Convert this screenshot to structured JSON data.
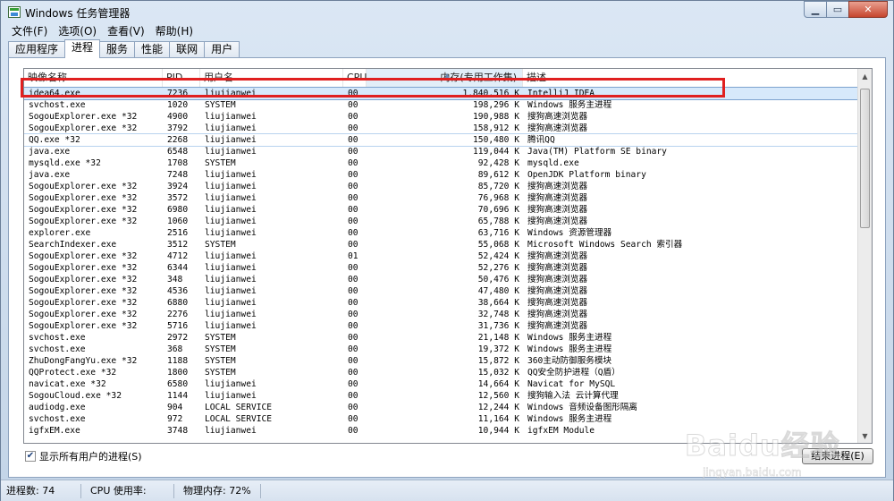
{
  "window": {
    "title": "Windows 任务管理器",
    "controls": [
      "▁",
      "▭",
      "✕"
    ]
  },
  "menu": [
    "文件(F)",
    "选项(O)",
    "查看(V)",
    "帮助(H)"
  ],
  "tabs": [
    {
      "label": "应用程序",
      "active": false
    },
    {
      "label": "进程",
      "active": true
    },
    {
      "label": "服务",
      "active": false
    },
    {
      "label": "性能",
      "active": false
    },
    {
      "label": "联网",
      "active": false
    },
    {
      "label": "用户",
      "active": false
    }
  ],
  "columns": {
    "name": "映像名称",
    "pid": "PID",
    "user": "用户名",
    "cpu": "CPU",
    "mem": "内存(专用工作集)",
    "desc": "描述"
  },
  "processes": [
    {
      "name": "idea64.exe",
      "pid": "7236",
      "user": "liujianwei",
      "cpu": "00",
      "mem": "1,840,516 K",
      "desc": "IntelliJ IDEA"
    },
    {
      "name": "svchost.exe",
      "pid": "1020",
      "user": "SYSTEM",
      "cpu": "00",
      "mem": "198,296 K",
      "desc": "Windows 服务主进程"
    },
    {
      "name": "SogouExplorer.exe *32",
      "pid": "4900",
      "user": "liujianwei",
      "cpu": "00",
      "mem": "190,988 K",
      "desc": "搜狗高速浏览器"
    },
    {
      "name": "SogouExplorer.exe *32",
      "pid": "3792",
      "user": "liujianwei",
      "cpu": "00",
      "mem": "158,912 K",
      "desc": "搜狗高速浏览器"
    },
    {
      "name": "QQ.exe *32",
      "pid": "2268",
      "user": "liujianwei",
      "cpu": "00",
      "mem": "150,480 K",
      "desc": "腾讯QQ"
    },
    {
      "name": "java.exe",
      "pid": "6548",
      "user": "liujianwei",
      "cpu": "00",
      "mem": "119,044 K",
      "desc": "Java(TM) Platform SE binary"
    },
    {
      "name": "mysqld.exe *32",
      "pid": "1708",
      "user": "SYSTEM",
      "cpu": "00",
      "mem": "92,428 K",
      "desc": "mysqld.exe"
    },
    {
      "name": "java.exe",
      "pid": "7248",
      "user": "liujianwei",
      "cpu": "00",
      "mem": "89,612 K",
      "desc": "OpenJDK Platform binary"
    },
    {
      "name": "SogouExplorer.exe *32",
      "pid": "3924",
      "user": "liujianwei",
      "cpu": "00",
      "mem": "85,720 K",
      "desc": "搜狗高速浏览器"
    },
    {
      "name": "SogouExplorer.exe *32",
      "pid": "3572",
      "user": "liujianwei",
      "cpu": "00",
      "mem": "76,968 K",
      "desc": "搜狗高速浏览器"
    },
    {
      "name": "SogouExplorer.exe *32",
      "pid": "6980",
      "user": "liujianwei",
      "cpu": "00",
      "mem": "70,696 K",
      "desc": "搜狗高速浏览器"
    },
    {
      "name": "SogouExplorer.exe *32",
      "pid": "1060",
      "user": "liujianwei",
      "cpu": "00",
      "mem": "65,788 K",
      "desc": "搜狗高速浏览器"
    },
    {
      "name": "explorer.exe",
      "pid": "2516",
      "user": "liujianwei",
      "cpu": "00",
      "mem": "63,716 K",
      "desc": "Windows 资源管理器"
    },
    {
      "name": "SearchIndexer.exe",
      "pid": "3512",
      "user": "SYSTEM",
      "cpu": "00",
      "mem": "55,068 K",
      "desc": "Microsoft Windows Search 索引器"
    },
    {
      "name": "SogouExplorer.exe *32",
      "pid": "4712",
      "user": "liujianwei",
      "cpu": "01",
      "mem": "52,424 K",
      "desc": "搜狗高速浏览器"
    },
    {
      "name": "SogouExplorer.exe *32",
      "pid": "6344",
      "user": "liujianwei",
      "cpu": "00",
      "mem": "52,276 K",
      "desc": "搜狗高速浏览器"
    },
    {
      "name": "SogouExplorer.exe *32",
      "pid": "348",
      "user": "liujianwei",
      "cpu": "00",
      "mem": "50,476 K",
      "desc": "搜狗高速浏览器"
    },
    {
      "name": "SogouExplorer.exe *32",
      "pid": "4536",
      "user": "liujianwei",
      "cpu": "00",
      "mem": "47,480 K",
      "desc": "搜狗高速浏览器"
    },
    {
      "name": "SogouExplorer.exe *32",
      "pid": "6880",
      "user": "liujianwei",
      "cpu": "00",
      "mem": "38,664 K",
      "desc": "搜狗高速浏览器"
    },
    {
      "name": "SogouExplorer.exe *32",
      "pid": "2276",
      "user": "liujianwei",
      "cpu": "00",
      "mem": "32,748 K",
      "desc": "搜狗高速浏览器"
    },
    {
      "name": "SogouExplorer.exe *32",
      "pid": "5716",
      "user": "liujianwei",
      "cpu": "00",
      "mem": "31,736 K",
      "desc": "搜狗高速浏览器"
    },
    {
      "name": "svchost.exe",
      "pid": "2972",
      "user": "SYSTEM",
      "cpu": "00",
      "mem": "21,148 K",
      "desc": "Windows 服务主进程"
    },
    {
      "name": "svchost.exe",
      "pid": "368",
      "user": "SYSTEM",
      "cpu": "00",
      "mem": "19,372 K",
      "desc": "Windows 服务主进程"
    },
    {
      "name": "ZhuDongFangYu.exe *32",
      "pid": "1188",
      "user": "SYSTEM",
      "cpu": "00",
      "mem": "15,872 K",
      "desc": "360主动防御服务模块"
    },
    {
      "name": "QQProtect.exe *32",
      "pid": "1800",
      "user": "SYSTEM",
      "cpu": "00",
      "mem": "15,032 K",
      "desc": "QQ安全防护进程（Q盾）"
    },
    {
      "name": "navicat.exe *32",
      "pid": "6580",
      "user": "liujianwei",
      "cpu": "00",
      "mem": "14,664 K",
      "desc": "Navicat for MySQL"
    },
    {
      "name": "SogouCloud.exe *32",
      "pid": "1144",
      "user": "liujianwei",
      "cpu": "00",
      "mem": "12,560 K",
      "desc": "搜狗输入法 云计算代理"
    },
    {
      "name": "audiodg.exe",
      "pid": "904",
      "user": "LOCAL SERVICE",
      "cpu": "00",
      "mem": "12,244 K",
      "desc": "Windows 音频设备图形隔离"
    },
    {
      "name": "svchost.exe",
      "pid": "972",
      "user": "LOCAL SERVICE",
      "cpu": "00",
      "mem": "11,164 K",
      "desc": "Windows 服务主进程"
    },
    {
      "name": "igfxEM.exe",
      "pid": "3748",
      "user": "liujianwei",
      "cpu": "00",
      "mem": "10,944 K",
      "desc": "igfxEM Module"
    }
  ],
  "show_all_users": {
    "label": "显示所有用户的进程(S)",
    "checked": true
  },
  "end_process_button": "结束进程(E)",
  "status": {
    "processes": "进程数: 74",
    "cpu": "CPU 使用率: 7%",
    "memory": "物理内存: 72%"
  },
  "watermark": {
    "text": "Baidu经验",
    "url": "jingyan.baidu.com"
  },
  "highlight_color": "#e02020",
  "selection_color": "#d7e9fb"
}
